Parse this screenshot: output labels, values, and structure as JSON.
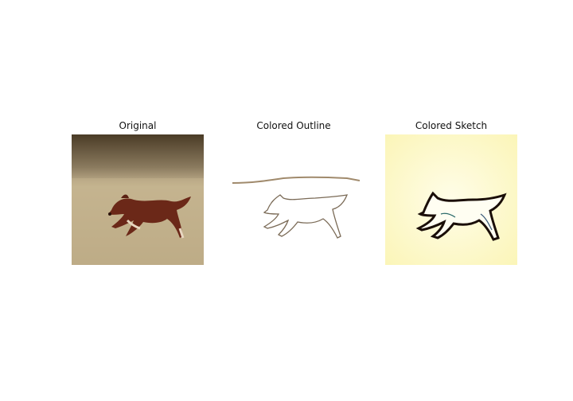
{
  "panels": [
    {
      "title": "Original",
      "image": "running-dog-photo"
    },
    {
      "title": "Colored Outline",
      "image": "dog-outline-drawing"
    },
    {
      "title": "Colored Sketch",
      "image": "dog-sketch-drawing"
    }
  ]
}
